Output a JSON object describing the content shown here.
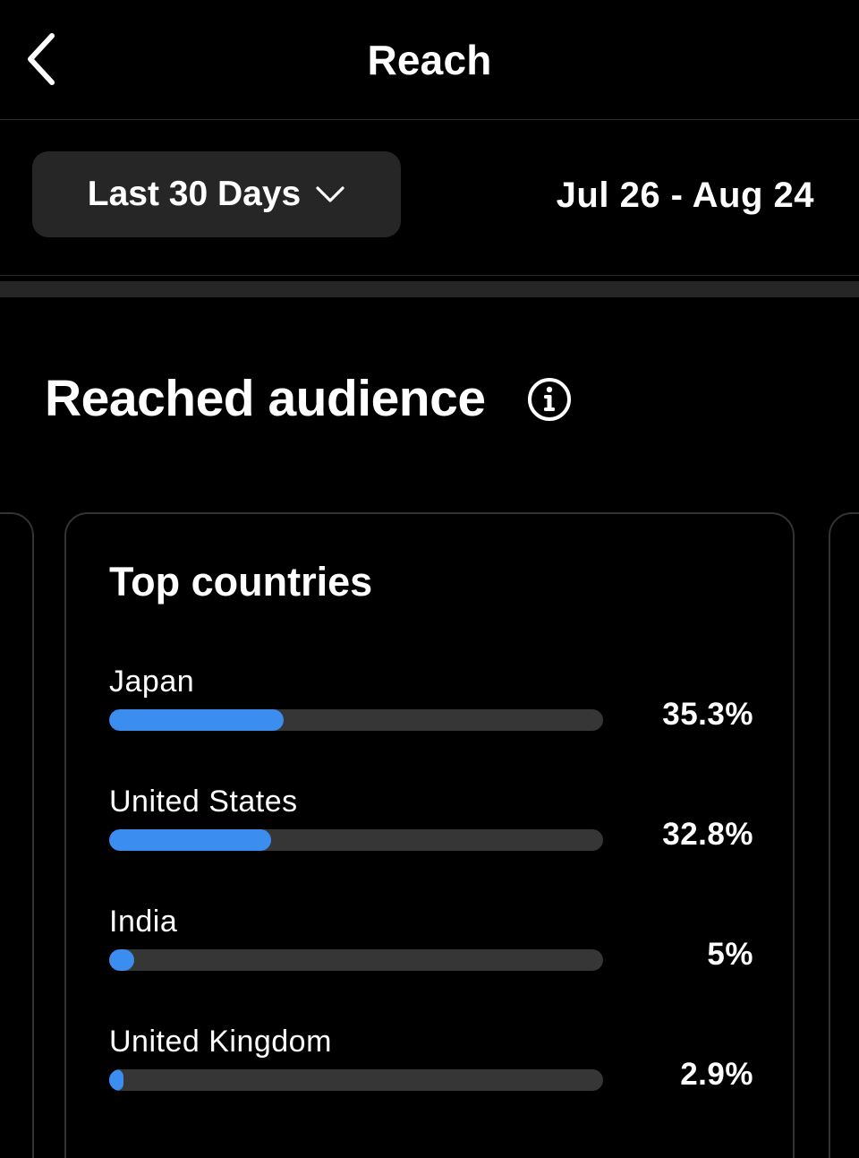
{
  "header": {
    "title": "Reach",
    "back_icon": "chevron-left-icon"
  },
  "filter": {
    "range_label": "Last 30 Days",
    "dropdown_icon": "chevron-down-icon",
    "date_range": "Jul 26 - Aug 24"
  },
  "section": {
    "title": "Reached audience",
    "info_icon": "info-icon"
  },
  "top_countries": {
    "title": "Top countries",
    "bar_color": "#3b8df0",
    "items": [
      {
        "name": "Japan",
        "percent_label": "35.3%",
        "percent": 35.3
      },
      {
        "name": "United States",
        "percent_label": "32.8%",
        "percent": 32.8
      },
      {
        "name": "India",
        "percent_label": "5%",
        "percent": 5
      },
      {
        "name": "United Kingdom",
        "percent_label": "2.9%",
        "percent": 2.9
      }
    ]
  }
}
